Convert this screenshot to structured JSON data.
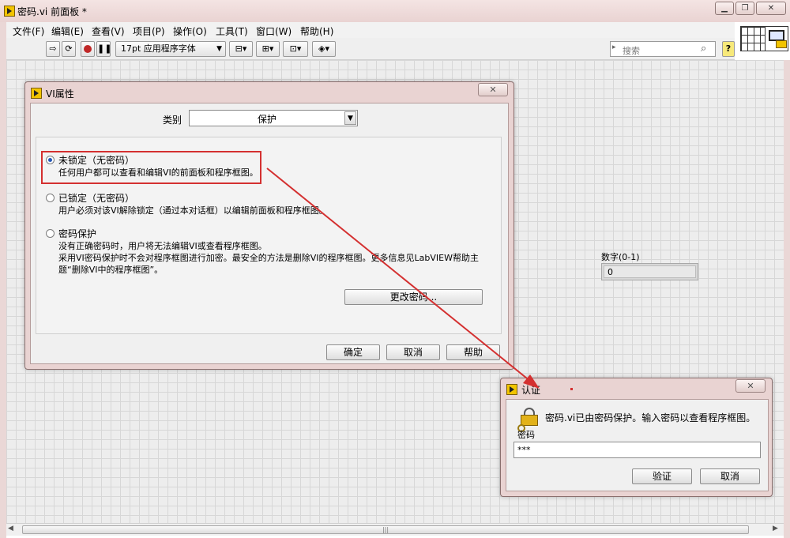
{
  "window": {
    "title": "密码.vi 前面板 *",
    "controls": [
      "▁",
      "❐",
      "✕"
    ]
  },
  "menu": [
    "文件(F)",
    "编辑(E)",
    "查看(V)",
    "项目(P)",
    "操作(O)",
    "工具(T)",
    "窗口(W)",
    "帮助(H)"
  ],
  "toolbar": {
    "font_value": "17pt 应用程序字体",
    "search_placeholder": "搜索",
    "help_label": "?"
  },
  "front_panel": {
    "numeric_label": "数字(0-1)",
    "numeric_value": "0"
  },
  "scrollbar": {
    "grip": "|||"
  },
  "vi_properties": {
    "title": "VI属性",
    "category_label": "类别",
    "category_value": "保护",
    "options": [
      {
        "label": "未锁定（无密码）",
        "desc": "任何用户都可以查看和编辑VI的前面板和程序框图。",
        "selected": true
      },
      {
        "label": "已锁定（无密码）",
        "desc": "用户必须对该VI解除锁定（通过本对话框）以编辑前面板和程序框图。",
        "selected": false
      },
      {
        "label": "密码保护",
        "desc1": "没有正确密码时，用户将无法编辑VI或查看程序框图。",
        "desc2": "采用VI密码保护时不会对程序框图进行加密。最安全的方法是删除VI的程序框图。更多信息见LabVIEW帮助主",
        "desc3": "题“删除VI中的程序框图”。",
        "selected": false
      }
    ],
    "change_password_button": "更改密码...",
    "ok_button": "确定",
    "cancel_button": "取消",
    "help_button": "帮助"
  },
  "auth_dialog": {
    "title": "认证",
    "message": "密码.vi已由密码保护。输入密码以查看程序框图。",
    "password_label": "密码",
    "password_value": "***",
    "verify_button": "验证",
    "cancel_button": "取消"
  },
  "annotation": {
    "color": "#d43030"
  }
}
